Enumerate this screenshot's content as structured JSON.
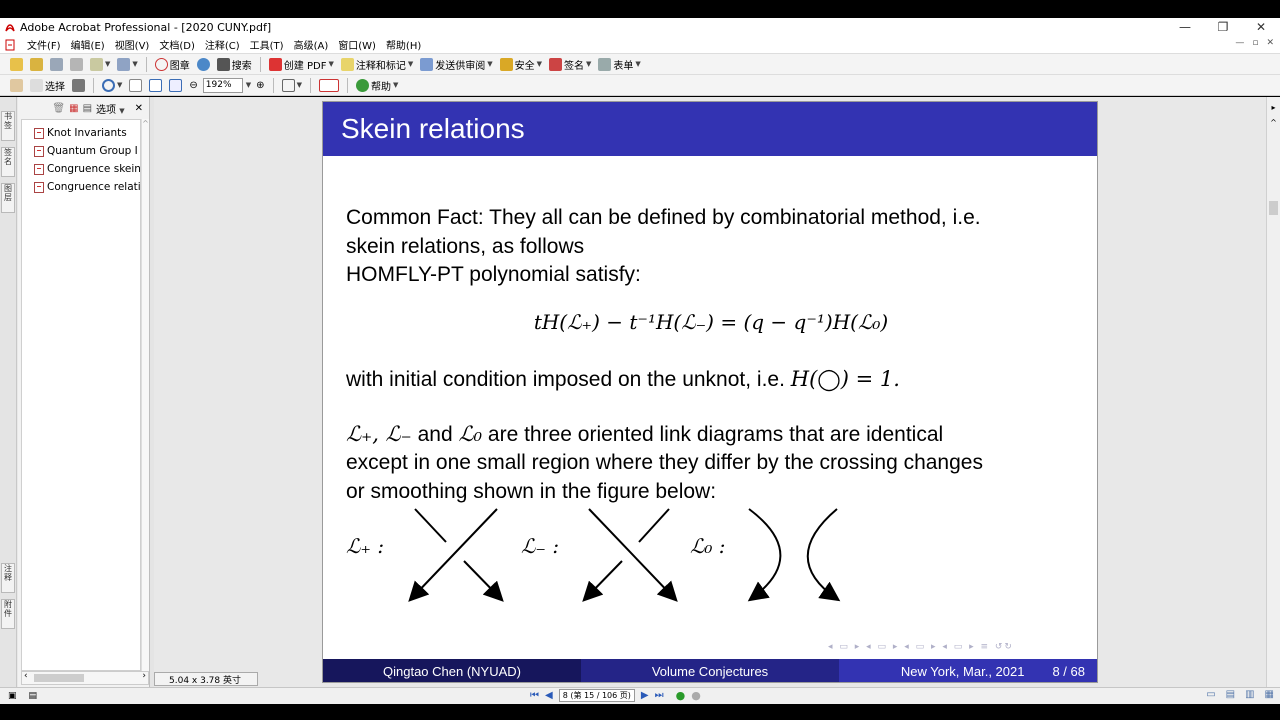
{
  "window": {
    "title": "Adobe Acrobat Professional - [2020 CUNY.pdf]"
  },
  "menu": {
    "items": [
      "文件(F)",
      "编辑(E)",
      "视图(V)",
      "文档(D)",
      "注释(C)",
      "工具(T)",
      "高级(A)",
      "窗口(W)",
      "帮助(H)"
    ]
  },
  "toolbar1": {
    "organize_label": "图章",
    "search_label": "搜索",
    "create_pdf_label": "创建 PDF",
    "comment_label": "注释和标记",
    "send_review_label": "发送供审阅",
    "secure_label": "安全",
    "sign_label": "签名",
    "forms_label": "表单"
  },
  "toolbar2": {
    "select_label": "选择",
    "zoom_value": "192%",
    "help_label": "帮助"
  },
  "nav": {
    "options_label": "选项",
    "tabs_top": [
      "书签",
      "签名",
      "图层"
    ],
    "tabs_bottom": [
      "注释",
      "附件"
    ],
    "bookmarks": [
      "Knot Invariants",
      "Quantum Group I",
      "Congruence skein",
      "Congruence relati"
    ]
  },
  "page_size": "5.04 x 3.78 英寸",
  "slide": {
    "title": "Skein relations",
    "line1": "Common Fact: They all can be defined by combinatorial method, i.e.",
    "line2": "skein relations, as follows",
    "line3": "HOMFLY-PT polynomial satisfy:",
    "formula": "tH(ℒ₊) − t⁻¹H(ℒ₋) = (q − q⁻¹)H(ℒ₀)",
    "condition_text": "with initial condition imposed on the unknot, i.e.",
    "condition_math": "H(◯) = 1.",
    "para_math": "ℒ₊, ℒ₋",
    "para_and": "and",
    "para_math2": "ℒ₀",
    "para_rest": "are three oriented link diagrams that are identical",
    "para_line2": "except in one small region where they differ by the crossing changes",
    "para_line3": "or smoothing shown in the figure below:",
    "label_plus": "ℒ₊ :",
    "label_minus": "ℒ₋ :",
    "label_zero": "ℒ₀ :",
    "footer_author": "Qingtao Chen  (NYUAD)",
    "footer_title": "Volume Conjectures",
    "footer_place": "New York, Mar., 2021",
    "footer_page": "8 / 68",
    "header_color": "#3333b2"
  },
  "status": {
    "page_indicator": "8 (第 15 / 106 页)"
  }
}
